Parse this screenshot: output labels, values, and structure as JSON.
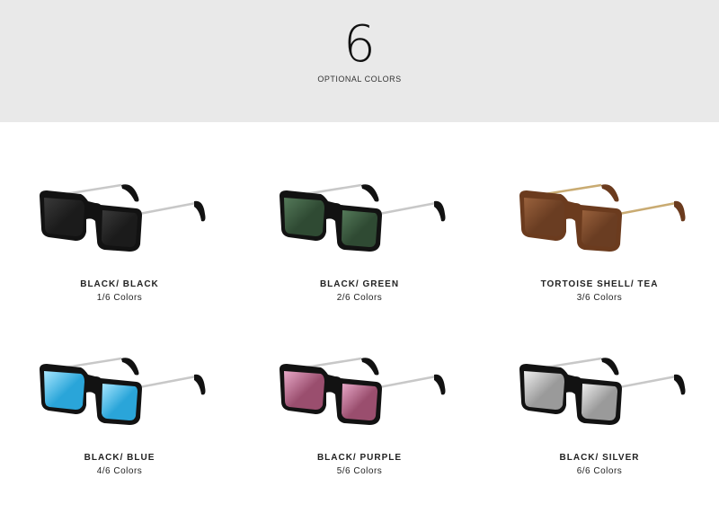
{
  "header": {
    "count": "6",
    "label": "OPTIONAL COLORS"
  },
  "products": [
    {
      "name": "BLACK/ BLACK",
      "sub": "1/6 Colors",
      "frame": "#121212",
      "lens": "#1b1b1b",
      "lens_hi": "#3a3a3a",
      "temple": "#c8c8c8"
    },
    {
      "name": "BLACK/ GREEN",
      "sub": "2/6 Colors",
      "frame": "#121212",
      "lens": "#2f4a33",
      "lens_hi": "#557a5a",
      "temple": "#c8c8c8"
    },
    {
      "name": "TORTOISE SHELL/ TEA",
      "sub": "3/6 Colors",
      "frame": "#6b3b1e",
      "lens": "#6a3d22",
      "lens_hi": "#9a623d",
      "temple": "#c9ab72"
    },
    {
      "name": "BLACK/ BLUE",
      "sub": "4/6 Colors",
      "frame": "#121212",
      "lens": "#2aa5d9",
      "lens_hi": "#a8e7ff",
      "temple": "#c8c8c8"
    },
    {
      "name": "BLACK/ PURPLE",
      "sub": "5/6 Colors",
      "frame": "#121212",
      "lens": "#9a4e6e",
      "lens_hi": "#e8a9c8",
      "temple": "#c8c8c8"
    },
    {
      "name": "BLACK/ SILVER",
      "sub": "6/6 Colors",
      "frame": "#121212",
      "lens": "#9a9a9a",
      "lens_hi": "#efefef",
      "temple": "#c8c8c8"
    }
  ]
}
